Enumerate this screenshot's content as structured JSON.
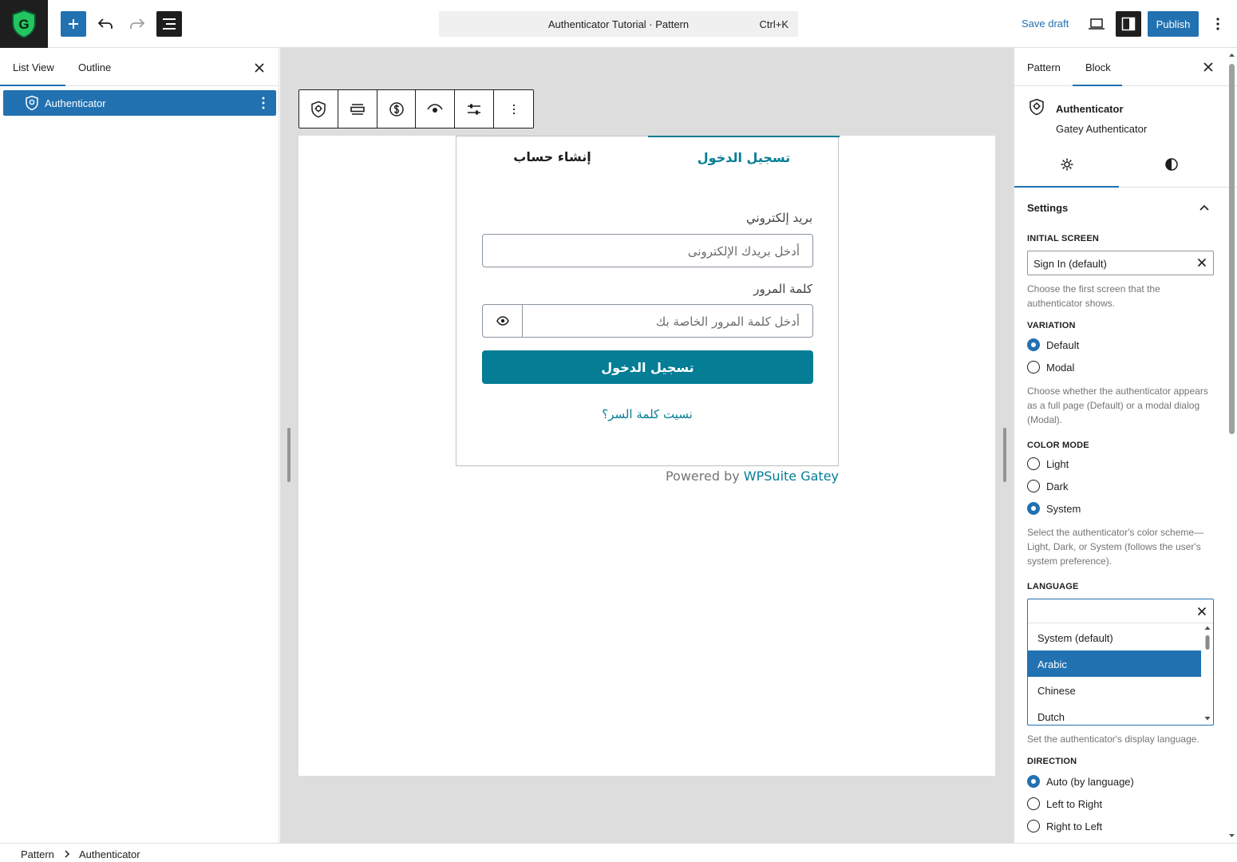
{
  "topbar": {
    "document_title": "Authenticator Tutorial · Pattern",
    "shortcut": "Ctrl+K",
    "save_draft_label": "Save draft",
    "publish_label": "Publish"
  },
  "colors": {
    "accent": "#2271b1",
    "auth_primary": "#047d95",
    "logo_green": "#22c55e"
  },
  "left_panel": {
    "tabs": [
      "List View",
      "Outline"
    ],
    "active_tab": "List View",
    "items": [
      {
        "label": "Authenticator",
        "icon": "shield-icon",
        "selected": true
      }
    ]
  },
  "block_toolbar": {
    "buttons": [
      "block-type-icon",
      "align-icon",
      "currency-icon",
      "eye-icon",
      "sliders-icon",
      "more-options-icon"
    ]
  },
  "authenticator": {
    "tabs": {
      "sign_in": "تسجيل الدخول",
      "create_account": "إنشاء حساب"
    },
    "email_label": "بريد إلكتروني",
    "email_placeholder": "أدخل بريدك الإلكترونى",
    "password_label": "كلمة المرور",
    "password_placeholder": "أدخل كلمة المرور الخاصة بك",
    "submit_label": "تسجيل الدخول",
    "forgot_link": "نسيت كلمة السر؟",
    "powered_by": "Powered by",
    "powered_brand": "WPSuite Gatey"
  },
  "right_panel": {
    "tabs": [
      "Pattern",
      "Block"
    ],
    "active_tab": "Block",
    "block_title": "Authenticator",
    "block_description": "Gatey Authenticator",
    "subtabs": [
      "settings-gear-icon",
      "styles-half-circle-icon"
    ],
    "section_title": "Settings",
    "initial_screen": {
      "label": "INITIAL SCREEN",
      "value": "Sign In (default)",
      "help": "Choose the first screen that the authenticator shows."
    },
    "variation": {
      "label": "VARIATION",
      "options": [
        "Default",
        "Modal"
      ],
      "selected": "Default",
      "help": "Choose whether the authenticator appears as a full page (Default) or a modal dialog (Modal)."
    },
    "color_mode": {
      "label": "COLOR MODE",
      "options": [
        "Light",
        "Dark",
        "System"
      ],
      "selected": "System",
      "help": "Select the authenticator's color scheme—Light, Dark, or System (follows the user's system preference)."
    },
    "language": {
      "label": "LANGUAGE",
      "input_value": "",
      "options": [
        "System (default)",
        "Arabic",
        "Chinese",
        "Dutch"
      ],
      "highlighted": "Arabic",
      "help": "Set the authenticator's display language."
    },
    "direction": {
      "label": "DIRECTION",
      "options": [
        "Auto (by language)",
        "Left to Right",
        "Right to Left"
      ],
      "selected": "Auto (by language)"
    }
  },
  "footer": {
    "breadcrumbs": [
      "Pattern",
      "Authenticator"
    ]
  }
}
